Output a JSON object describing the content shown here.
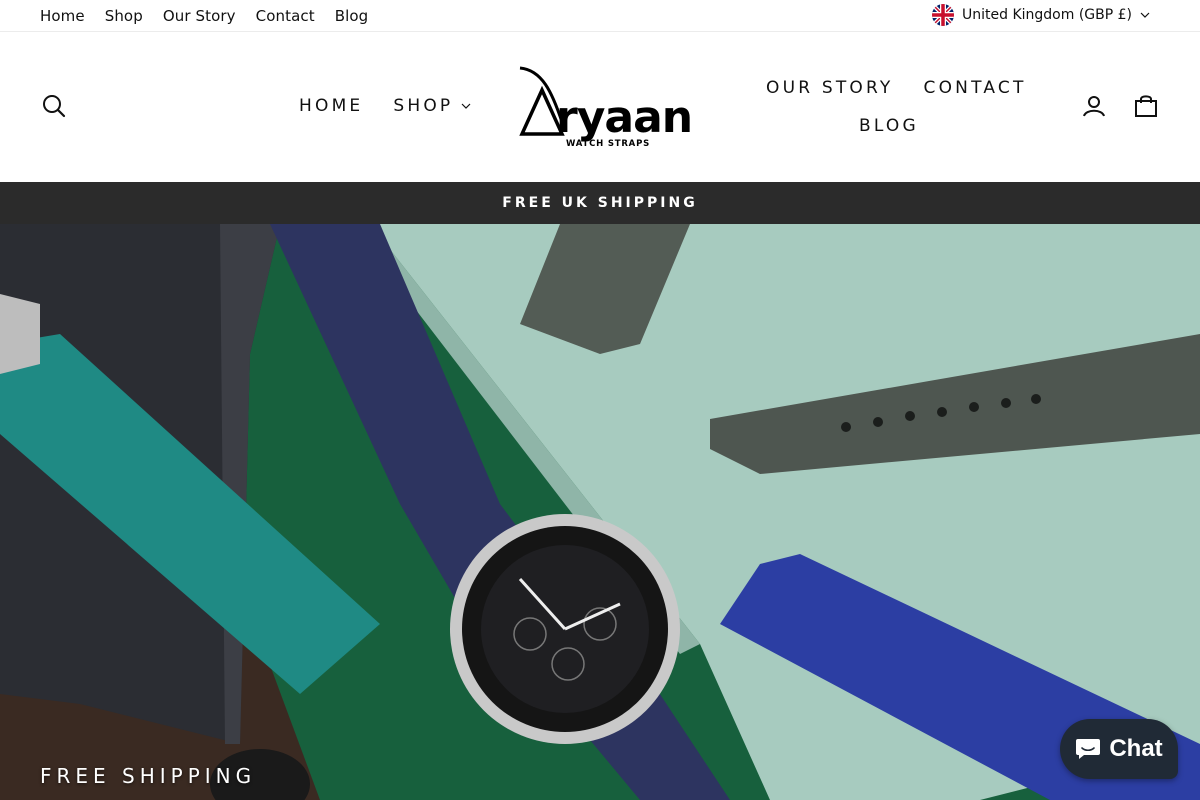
{
  "utility": {
    "links": [
      "Home",
      "Shop",
      "Our Story",
      "Contact",
      "Blog"
    ],
    "currency_label": "United Kingdom (GBP £)"
  },
  "nav": {
    "home": "HOME",
    "shop": "SHOP",
    "our_story": "OUR STORY",
    "contact": "CONTACT",
    "blog": "BLOG"
  },
  "logo": {
    "name": "Aryaan",
    "tagline": "WATCH STRAPS"
  },
  "announcement": "FREE UK SHIPPING",
  "hero": {
    "caption": "FREE SHIPPING"
  },
  "chat": {
    "label": "Chat"
  },
  "icons": {
    "search": "search-icon",
    "account": "account-icon",
    "cart": "cart-icon",
    "flag": "uk-flag-icon",
    "chat": "chat-bubble-icon"
  }
}
